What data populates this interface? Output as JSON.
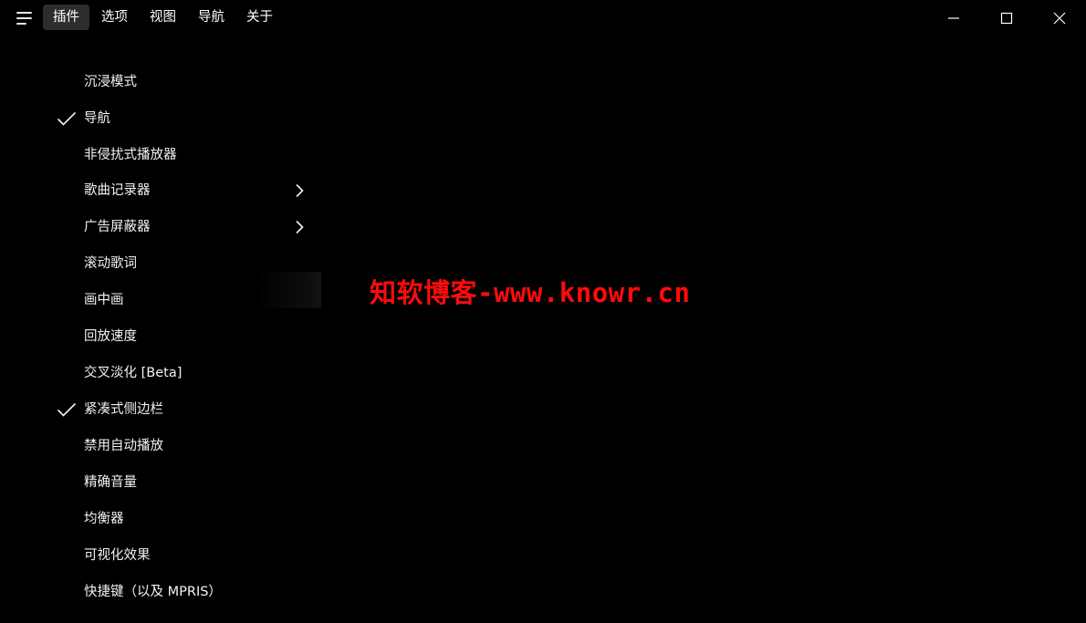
{
  "menubar": {
    "items": [
      {
        "label": "插件",
        "active": true
      },
      {
        "label": "选项",
        "active": false
      },
      {
        "label": "视图",
        "active": false
      },
      {
        "label": "导航",
        "active": false
      },
      {
        "label": "关于",
        "active": false
      }
    ]
  },
  "plugins_menu": {
    "items": [
      {
        "label": "沉浸模式",
        "checked": false,
        "submenu": false
      },
      {
        "label": "导航",
        "checked": true,
        "submenu": false
      },
      {
        "label": "非侵扰式播放器",
        "checked": false,
        "submenu": false
      },
      {
        "label": "歌曲记录器",
        "checked": false,
        "submenu": true
      },
      {
        "label": "广告屏蔽器",
        "checked": false,
        "submenu": true
      },
      {
        "label": "滚动歌词",
        "checked": false,
        "submenu": false
      },
      {
        "label": "画中画",
        "checked": false,
        "submenu": false
      },
      {
        "label": "回放速度",
        "checked": false,
        "submenu": false
      },
      {
        "label": "交叉淡化 [Beta]",
        "checked": false,
        "submenu": false
      },
      {
        "label": "紧凑式侧边栏",
        "checked": true,
        "submenu": false
      },
      {
        "label": "禁用自动播放",
        "checked": false,
        "submenu": false
      },
      {
        "label": "精确音量",
        "checked": false,
        "submenu": false
      },
      {
        "label": "均衡器",
        "checked": false,
        "submenu": false
      },
      {
        "label": "可视化效果",
        "checked": false,
        "submenu": false
      },
      {
        "label": "快捷键（以及 MPRIS）",
        "checked": false,
        "submenu": false
      }
    ]
  },
  "watermark": {
    "text": "知软博客-www.knowr.cn",
    "color": "#ff0b0b"
  },
  "colors": {
    "background": "#000000",
    "active_menu": "#2d2d2d",
    "text": "#f2f2f2"
  },
  "icons": {
    "menu": "hamburger-icon",
    "minimize": "minimize-icon",
    "maximize": "maximize-icon",
    "close": "close-icon",
    "check": "checkmark-icon",
    "submenu": "chevron-right-icon"
  }
}
